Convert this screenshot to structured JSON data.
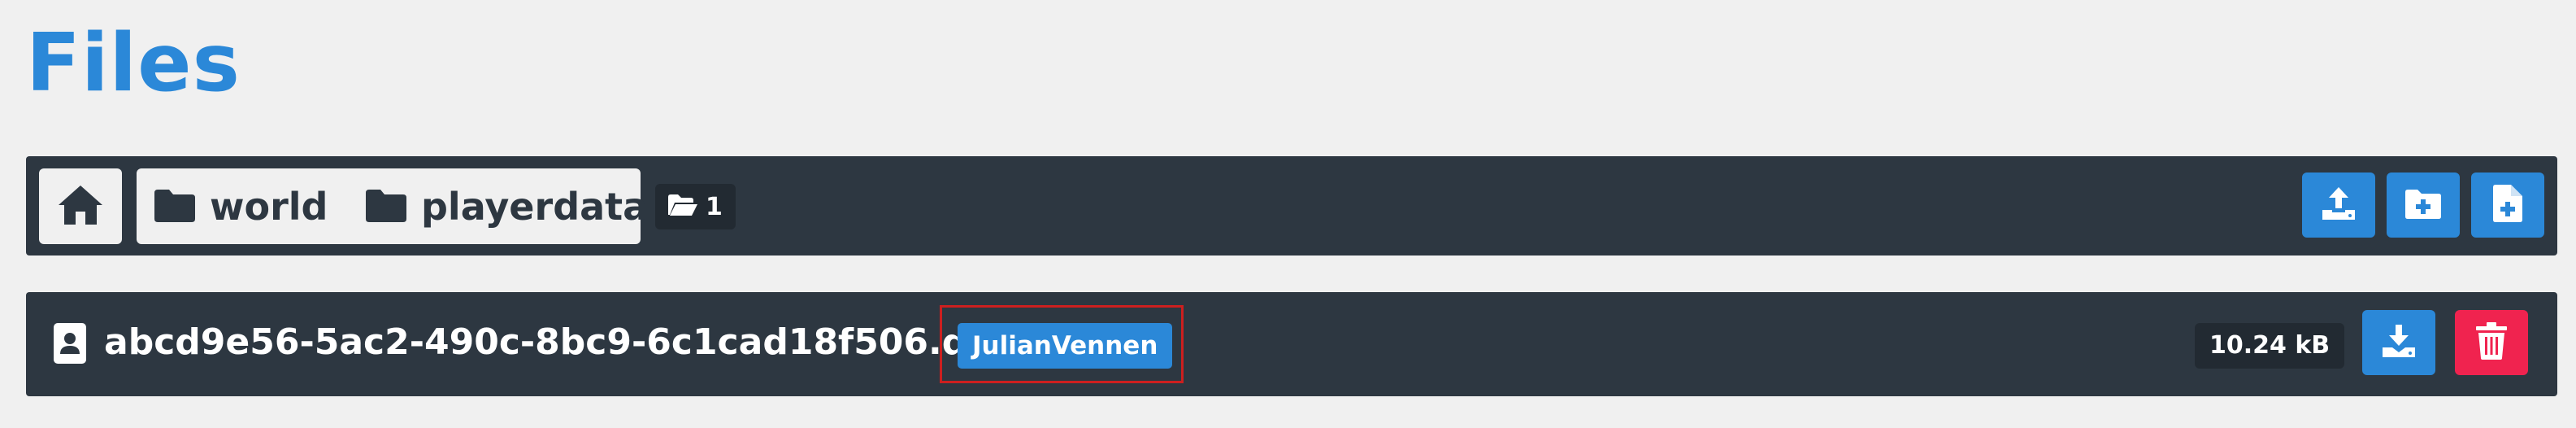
{
  "page": {
    "title": "Files"
  },
  "breadcrumb": {
    "home_icon": "home-icon",
    "items": [
      {
        "label": "world",
        "icon": "folder-icon"
      },
      {
        "label": "playerdata",
        "icon": "folder-icon"
      }
    ],
    "folder_count": "1",
    "folder_count_icon": "folder-open-icon"
  },
  "toolbar": {
    "actions": [
      {
        "name": "upload-button",
        "icon": "upload-icon"
      },
      {
        "name": "new-folder-button",
        "icon": "folder-plus-icon"
      },
      {
        "name": "new-file-button",
        "icon": "file-plus-icon"
      }
    ]
  },
  "files": [
    {
      "icon": "player-file-icon",
      "name": "abcd9e56-5ac2-490c-8bc9-6c1cad18f506.dat",
      "owner": "JulianVennen",
      "size": "10.24 kB",
      "download_icon": "download-icon",
      "delete_icon": "trash-icon"
    }
  ],
  "colors": {
    "accent": "#2b88d8",
    "bar_background": "#2d3741",
    "page_background": "#f0f0f0",
    "danger": "#f0234f",
    "highlight_border": "#cc1f1f"
  }
}
